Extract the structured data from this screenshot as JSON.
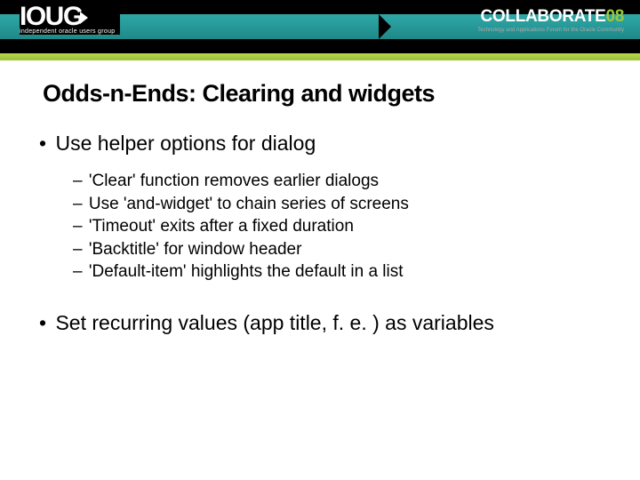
{
  "header": {
    "logo_text": "IOUG",
    "logo_subtitle": "independent oracle users group",
    "collab_text": "COLLABORATE",
    "collab_year": "08",
    "collab_tagline": "Technology and Applications Forum for the Oracle Community"
  },
  "slide": {
    "title": "Odds-n-Ends: Clearing and widgets",
    "bullets": [
      {
        "text": "Use helper options for dialog",
        "subitems": [
          "'Clear' function removes earlier dialogs",
          "Use 'and-widget' to chain series of screens",
          "'Timeout' exits after a fixed duration",
          "'Backtitle' for window header",
          "'Default-item' highlights the default in a list"
        ]
      },
      {
        "text": "Set recurring values (app title, f. e. ) as variables",
        "subitems": []
      }
    ]
  }
}
